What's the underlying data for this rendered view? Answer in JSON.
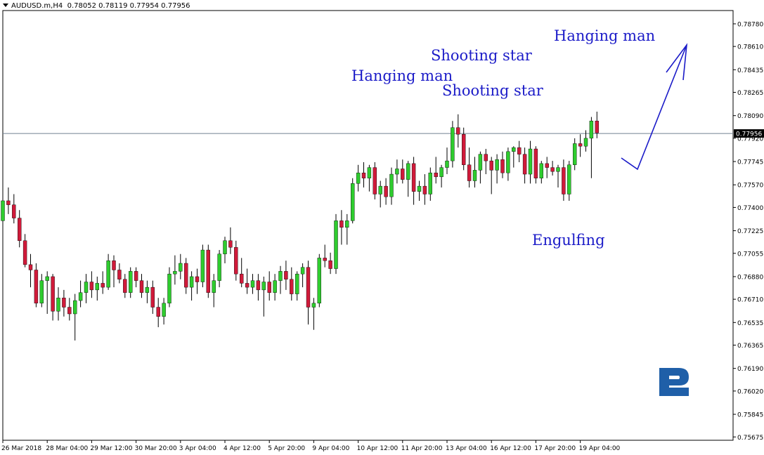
{
  "header": {
    "symbol": "AUDUSD.m,H4",
    "ohlc": "0.78052 0.78119 0.77954 0.77956"
  },
  "annotations": [
    {
      "text": "Hanging man"
    },
    {
      "text": "Shooting star"
    },
    {
      "text": "Hanging man"
    },
    {
      "text": "Shooting star"
    },
    {
      "text": "Engulfing"
    }
  ],
  "colors": {
    "bull": "#2ecc2e",
    "bear": "#d01a3a",
    "wick": "#000000",
    "grid_frame": "#000000",
    "price_line": "#708090",
    "annotation": "#1b1bc8",
    "logo": "#1f5fa8"
  },
  "icons": {
    "arrow": "up-right-arrow-icon",
    "logo": "rf-logo-icon"
  },
  "chart_data": {
    "type": "candlestick",
    "symbol": "AUDUSD.m",
    "timeframe": "H4",
    "current_price": "0.77956",
    "ylim": [
      0.7565,
      0.7888
    ],
    "yticks": [
      "0.78780",
      "0.78610",
      "0.78435",
      "0.78265",
      "0.78090",
      "0.77920",
      "0.77745",
      "0.77570",
      "0.77400",
      "0.77225",
      "0.77055",
      "0.76880",
      "0.76710",
      "0.76535",
      "0.76365",
      "0.76190",
      "0.76020",
      "0.75845",
      "0.75675"
    ],
    "xticks": [
      {
        "label": "26 Mar 2018",
        "bar": 0
      },
      {
        "label": "28 Mar 04:00",
        "bar": 8
      },
      {
        "label": "29 Mar 12:00",
        "bar": 16
      },
      {
        "label": "30 Mar 20:00",
        "bar": 24
      },
      {
        "label": "3 Apr 04:00",
        "bar": 32
      },
      {
        "label": "4 Apr 12:00",
        "bar": 40
      },
      {
        "label": "5 Apr 20:00",
        "bar": 48
      },
      {
        "label": "9 Apr 04:00",
        "bar": 56
      },
      {
        "label": "10 Apr 12:00",
        "bar": 64
      },
      {
        "label": "11 Apr 20:00",
        "bar": 72
      },
      {
        "label": "13 Apr 04:00",
        "bar": 80
      },
      {
        "label": "16 Apr 12:00",
        "bar": 88
      },
      {
        "label": "17 Apr 20:00",
        "bar": 96
      },
      {
        "label": "19 Apr 04:00",
        "bar": 104
      }
    ],
    "candles": [
      [
        0.773,
        0.775,
        0.7725,
        0.7745
      ],
      [
        0.7745,
        0.7755,
        0.7735,
        0.7742
      ],
      [
        0.7742,
        0.775,
        0.7728,
        0.7732
      ],
      [
        0.7732,
        0.7738,
        0.771,
        0.7715
      ],
      [
        0.7715,
        0.772,
        0.7695,
        0.7697
      ],
      [
        0.7697,
        0.7705,
        0.768,
        0.7693
      ],
      [
        0.7693,
        0.7698,
        0.7665,
        0.7668
      ],
      [
        0.7668,
        0.769,
        0.7665,
        0.7685
      ],
      [
        0.7685,
        0.7692,
        0.766,
        0.7688
      ],
      [
        0.7688,
        0.769,
        0.7655,
        0.7662
      ],
      [
        0.7662,
        0.768,
        0.7655,
        0.7672
      ],
      [
        0.7672,
        0.7678,
        0.7658,
        0.7665
      ],
      [
        0.7665,
        0.7672,
        0.7655,
        0.766
      ],
      [
        0.766,
        0.7675,
        0.764,
        0.767
      ],
      [
        0.767,
        0.7685,
        0.7665,
        0.7676
      ],
      [
        0.7676,
        0.769,
        0.7668,
        0.7684
      ],
      [
        0.7684,
        0.7692,
        0.7672,
        0.7678
      ],
      [
        0.7678,
        0.7688,
        0.767,
        0.7683
      ],
      [
        0.7683,
        0.7692,
        0.7675,
        0.768
      ],
      [
        0.768,
        0.7705,
        0.7678,
        0.77
      ],
      [
        0.77,
        0.7704,
        0.768,
        0.7693
      ],
      [
        0.7693,
        0.7698,
        0.7683,
        0.7686
      ],
      [
        0.7686,
        0.769,
        0.7672,
        0.7676
      ],
      [
        0.7676,
        0.7695,
        0.7672,
        0.7692
      ],
      [
        0.7692,
        0.7695,
        0.768,
        0.7685
      ],
      [
        0.7685,
        0.769,
        0.7672,
        0.7676
      ],
      [
        0.7676,
        0.7685,
        0.7668,
        0.768
      ],
      [
        0.768,
        0.7685,
        0.766,
        0.7665
      ],
      [
        0.7665,
        0.7672,
        0.765,
        0.7658
      ],
      [
        0.7658,
        0.7672,
        0.7652,
        0.7668
      ],
      [
        0.7668,
        0.7695,
        0.7665,
        0.769
      ],
      [
        0.769,
        0.7704,
        0.7682,
        0.7692
      ],
      [
        0.7692,
        0.7705,
        0.7686,
        0.7698
      ],
      [
        0.7698,
        0.7702,
        0.7675,
        0.768
      ],
      [
        0.768,
        0.7692,
        0.767,
        0.7688
      ],
      [
        0.7688,
        0.7694,
        0.7675,
        0.7684
      ],
      [
        0.7684,
        0.7712,
        0.768,
        0.7708
      ],
      [
        0.7708,
        0.7712,
        0.7672,
        0.7676
      ],
      [
        0.7676,
        0.769,
        0.7665,
        0.7685
      ],
      [
        0.7685,
        0.7708,
        0.768,
        0.7705
      ],
      [
        0.7705,
        0.7718,
        0.7698,
        0.7715
      ],
      [
        0.7715,
        0.7725,
        0.7705,
        0.771
      ],
      [
        0.771,
        0.7715,
        0.7685,
        0.769
      ],
      [
        0.769,
        0.7702,
        0.768,
        0.7683
      ],
      [
        0.7683,
        0.7694,
        0.7675,
        0.768
      ],
      [
        0.768,
        0.769,
        0.7675,
        0.7685
      ],
      [
        0.7685,
        0.769,
        0.767,
        0.7678
      ],
      [
        0.7678,
        0.7688,
        0.7658,
        0.7684
      ],
      [
        0.7684,
        0.7692,
        0.767,
        0.7676
      ],
      [
        0.7676,
        0.769,
        0.767,
        0.7685
      ],
      [
        0.7685,
        0.7696,
        0.7675,
        0.7692
      ],
      [
        0.7692,
        0.77,
        0.7678,
        0.7686
      ],
      [
        0.7686,
        0.7695,
        0.767,
        0.7675
      ],
      [
        0.7675,
        0.7692,
        0.767,
        0.769
      ],
      [
        0.769,
        0.7698,
        0.768,
        0.7695
      ],
      [
        0.7695,
        0.77,
        0.7652,
        0.7665
      ],
      [
        0.7665,
        0.7672,
        0.7648,
        0.7668
      ],
      [
        0.7668,
        0.7705,
        0.7665,
        0.7702
      ],
      [
        0.7702,
        0.7712,
        0.7695,
        0.77
      ],
      [
        0.77,
        0.7706,
        0.769,
        0.7694
      ],
      [
        0.7694,
        0.7735,
        0.769,
        0.773
      ],
      [
        0.773,
        0.7738,
        0.7712,
        0.7725
      ],
      [
        0.7725,
        0.7735,
        0.7712,
        0.773
      ],
      [
        0.773,
        0.7762,
        0.7728,
        0.7758
      ],
      [
        0.7758,
        0.7772,
        0.7752,
        0.7766
      ],
      [
        0.7766,
        0.7774,
        0.7755,
        0.7762
      ],
      [
        0.7762,
        0.7772,
        0.7752,
        0.777
      ],
      [
        0.777,
        0.7774,
        0.7746,
        0.775
      ],
      [
        0.775,
        0.776,
        0.774,
        0.7756
      ],
      [
        0.7756,
        0.7762,
        0.7742,
        0.7748
      ],
      [
        0.7748,
        0.777,
        0.7742,
        0.7765
      ],
      [
        0.7765,
        0.7776,
        0.7758,
        0.7769
      ],
      [
        0.7769,
        0.7776,
        0.7758,
        0.7761
      ],
      [
        0.7761,
        0.7775,
        0.7748,
        0.7773
      ],
      [
        0.7773,
        0.7778,
        0.7742,
        0.7752
      ],
      [
        0.7752,
        0.776,
        0.7745,
        0.7756
      ],
      [
        0.7756,
        0.7765,
        0.7742,
        0.775
      ],
      [
        0.775,
        0.777,
        0.7745,
        0.7766
      ],
      [
        0.7766,
        0.7778,
        0.7758,
        0.7763
      ],
      [
        0.7763,
        0.7772,
        0.7755,
        0.777
      ],
      [
        0.777,
        0.7785,
        0.7765,
        0.7775
      ],
      [
        0.7775,
        0.7805,
        0.777,
        0.78
      ],
      [
        0.78,
        0.781,
        0.7785,
        0.7795
      ],
      [
        0.7795,
        0.78,
        0.7768,
        0.7772
      ],
      [
        0.7772,
        0.7785,
        0.7755,
        0.776
      ],
      [
        0.776,
        0.7778,
        0.7755,
        0.7768
      ],
      [
        0.7768,
        0.7782,
        0.7758,
        0.778
      ],
      [
        0.778,
        0.7784,
        0.7765,
        0.7775
      ],
      [
        0.7775,
        0.7778,
        0.775,
        0.7768
      ],
      [
        0.7768,
        0.778,
        0.7758,
        0.7776
      ],
      [
        0.7776,
        0.7782,
        0.7762,
        0.7766
      ],
      [
        0.7766,
        0.7785,
        0.776,
        0.7782
      ],
      [
        0.7782,
        0.7786,
        0.777,
        0.7785
      ],
      [
        0.7785,
        0.779,
        0.7774,
        0.778
      ],
      [
        0.778,
        0.7785,
        0.7758,
        0.7765
      ],
      [
        0.7765,
        0.779,
        0.7758,
        0.7784
      ],
      [
        0.7784,
        0.7786,
        0.7758,
        0.7762
      ],
      [
        0.7762,
        0.7775,
        0.7758,
        0.7773
      ],
      [
        0.7773,
        0.7778,
        0.7762,
        0.777
      ],
      [
        0.777,
        0.7775,
        0.7764,
        0.7767
      ],
      [
        0.7767,
        0.7772,
        0.7755,
        0.777
      ],
      [
        0.777,
        0.7776,
        0.7745,
        0.775
      ],
      [
        0.775,
        0.7775,
        0.7745,
        0.7772
      ],
      [
        0.7772,
        0.7792,
        0.7768,
        0.7788
      ],
      [
        0.7788,
        0.7795,
        0.7778,
        0.7786
      ],
      [
        0.7786,
        0.7798,
        0.7782,
        0.7792
      ],
      [
        0.7792,
        0.7808,
        0.7762,
        0.7805
      ],
      [
        0.7805,
        0.7812,
        0.7792,
        0.7796
      ]
    ]
  }
}
